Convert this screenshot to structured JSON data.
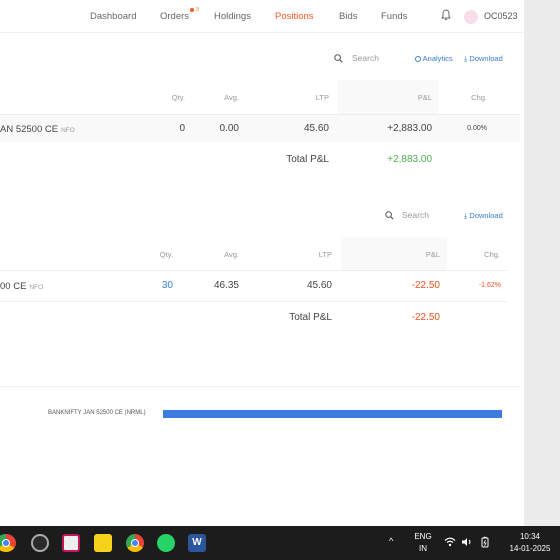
{
  "nav": {
    "items": [
      "Dashboard",
      "Orders",
      "Holdings",
      "Positions",
      "Bids",
      "Funds"
    ],
    "orders_badge": "3",
    "user_id": "OC0523"
  },
  "positions": {
    "search_placeholder": "Search",
    "analytics_label": "Analytics",
    "download_label": "Download",
    "headers": {
      "qty": "Qty.",
      "avg": "Avg.",
      "ltp": "LTP",
      "pnl": "P&L",
      "chg": "Chg."
    },
    "row": {
      "instrument": "AN 52500 CE",
      "exchange": "NFO",
      "qty": "0",
      "avg": "0.00",
      "ltp": "45.60",
      "pnl": "+2,883.00",
      "chg": "0.00%"
    },
    "total_label": "Total P&L",
    "total_value": "+2,883.00"
  },
  "day_positions": {
    "search_placeholder": "Search",
    "download_label": "Download",
    "headers": {
      "qty": "Qty.",
      "avg": "Avg.",
      "ltp": "LTP",
      "pnl": "P&L",
      "chg": "Chg."
    },
    "row": {
      "instrument": "00 CE",
      "exchange": "NFO",
      "qty": "30",
      "avg": "46.35",
      "ltp": "45.60",
      "pnl": "-22.50",
      "chg": "-1.62%"
    },
    "total_label": "Total P&L",
    "total_value": "-22.50"
  },
  "chart_data": {
    "type": "bar",
    "categories": [
      "BANKNIFTY JAN 52500 CE (NRML)"
    ],
    "values": [
      1
    ]
  },
  "taskbar": {
    "lang_top": "ENG",
    "lang_bottom": "IN",
    "time": "10:34",
    "date": "14-01-2025",
    "icons": [
      "chrome-icon",
      "settings-icon",
      "screenshot-icon",
      "sticky-notes-icon",
      "chrome-icon",
      "whatsapp-icon",
      "word-icon"
    ]
  },
  "colors": {
    "accent": "#ff5722",
    "link": "#387ed1",
    "profit": "#4caf50",
    "loss": "#f4511e",
    "bar": "#3a7ce0"
  }
}
